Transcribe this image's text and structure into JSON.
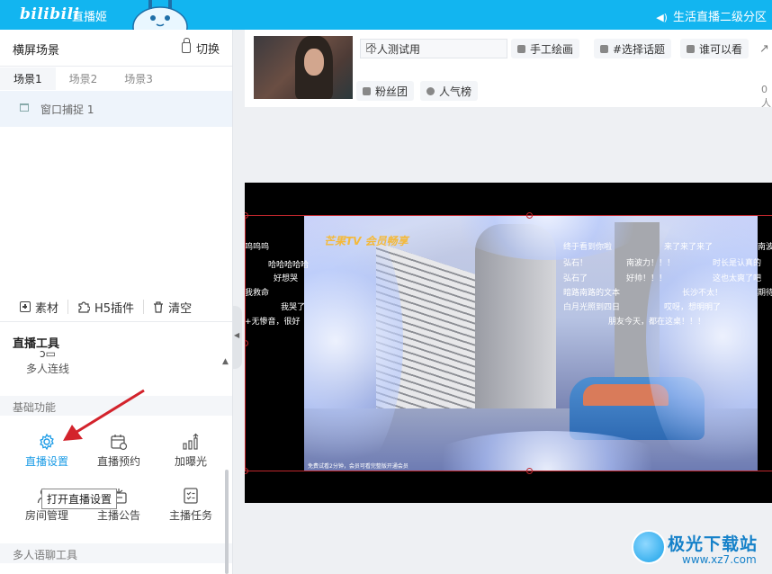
{
  "topbar": {
    "logo": "bilibili",
    "app_name": "直播姬",
    "zone": "生活直播二级分区",
    "colors": {
      "background": "#12b5f0"
    }
  },
  "scene_panel": {
    "title": "横屏场景",
    "switch_label": "切换",
    "tabs": [
      "场景1",
      "场景2",
      "场景3"
    ],
    "active_tab": "场景1",
    "sources": [
      {
        "label": "窗口捕捉 1"
      }
    ],
    "toolbar": {
      "material": "素材",
      "h5_plugin": "H5插件",
      "clear": "清空"
    }
  },
  "tools": {
    "title": "直播工具",
    "multi_link": "多人连线",
    "basic_section": "基础功能",
    "basic_items": [
      {
        "label": "直播设置",
        "icon": "gear-icon"
      },
      {
        "label": "直播预约",
        "icon": "calendar-clock-icon"
      },
      {
        "label": "加曝光",
        "icon": "bar-chart-up-icon"
      },
      {
        "label": "房间管理",
        "icon": "users-gear-icon"
      },
      {
        "label": "主播公告",
        "icon": "announcement-icon"
      },
      {
        "label": "主播任务",
        "icon": "task-list-icon"
      }
    ],
    "tooltip": "打开直播设置",
    "voice_section": "多人语聊工具"
  },
  "stream_info": {
    "title_value": "个人测试用",
    "chips": [
      "手工绘画",
      "#选择话题",
      "谁可以看",
      "粉丝团",
      "人气榜"
    ],
    "viewer_count": "0人"
  },
  "preview": {
    "video_logo": "芒果TV 会员畅享",
    "danmaku_left": [
      "呜呜呜",
      "哈哈哈哈哈",
      "好想哭",
      "我救命",
      "我哭了",
      "+无惨音，很好"
    ],
    "danmaku_right": [
      "终于看到你啦",
      "来了来了来了",
      "弘石！",
      "南波力！！！",
      "弘石了",
      "好帅！！！",
      "暗路南路的文本",
      "长沙不太！",
      "白月光照到四日",
      "哎呀，想明明了",
      "朋友今天，都在这桌！！！",
      "时长是认真的",
      "这也太爽了吧",
      "南波",
      "期待"
    ],
    "bottom_notice": "免费试看2分钟，会员可看完整版开通会员"
  },
  "watermark": {
    "brand": "极光下载站",
    "url": "www.xz7.com"
  }
}
